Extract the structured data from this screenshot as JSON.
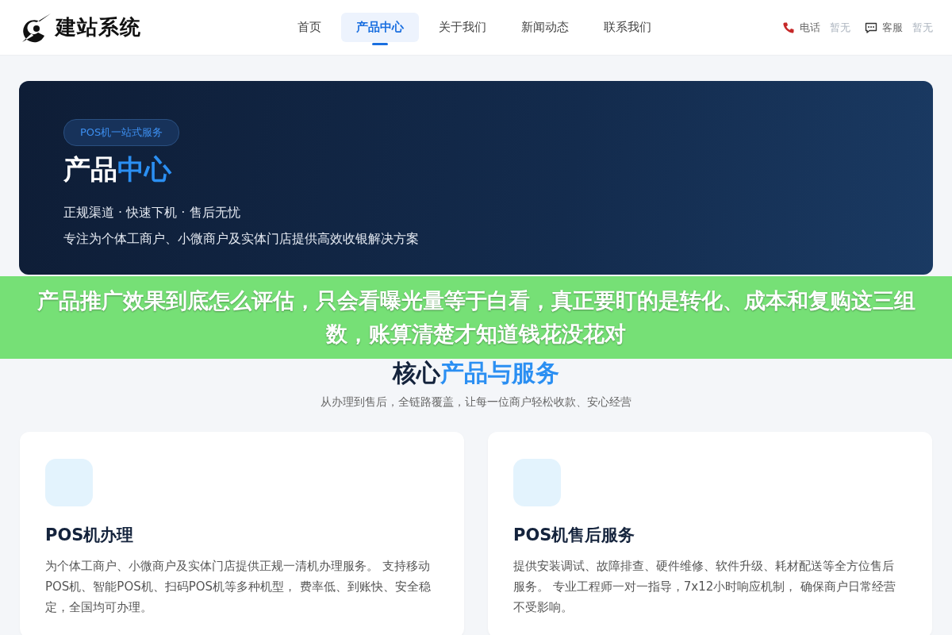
{
  "header": {
    "logo_text": "建站系统",
    "nav": [
      {
        "label": "首页",
        "selected": false
      },
      {
        "label": "产品中心",
        "selected": true
      },
      {
        "label": "关于我们",
        "selected": false
      },
      {
        "label": "新闻动态",
        "selected": false
      },
      {
        "label": "联系我们",
        "selected": false
      }
    ],
    "contacts": [
      {
        "kind": "phone",
        "label": "电话",
        "value": "暂无"
      },
      {
        "kind": "chat",
        "label": "客服",
        "value": "暂无"
      }
    ]
  },
  "hero": {
    "badge": "POS机一站式服务",
    "title_plain": "产品",
    "title_accent": "中心",
    "tagline": "正规渠道 · 快速下机 · 售后无忧",
    "description": "专注为个体工商户、小微商户及实体门店提供高效收银解决方案"
  },
  "overlay_banner": {
    "text": "产品推广效果到底怎么评估，只会看曝光量等于白看，真正要盯的是转化、成本和复购这三组数，账算清楚才知道钱花没花对"
  },
  "section": {
    "title_plain": "核心",
    "title_accent": "产品与服务",
    "subtitle": "从办理到售后，全链路覆盖，让每一位商户轻松收款、安心经营"
  },
  "cards": [
    {
      "title": "POS机办理",
      "description": "为个体工商户、小微商户及实体门店提供正规一清机办理服务。 支持移动POS机、智能POS机、扫码POS机等多种机型， 费率低、到账快、安全稳定，全国均可办理。"
    },
    {
      "title": "POS机售后服务",
      "description": "提供安装调试、故障排查、硬件维修、软件升级、耗材配送等全方位售后服务。 专业工程师一对一指导，7x12小时响应机制， 确保商户日常经营不受影响。"
    }
  ]
}
